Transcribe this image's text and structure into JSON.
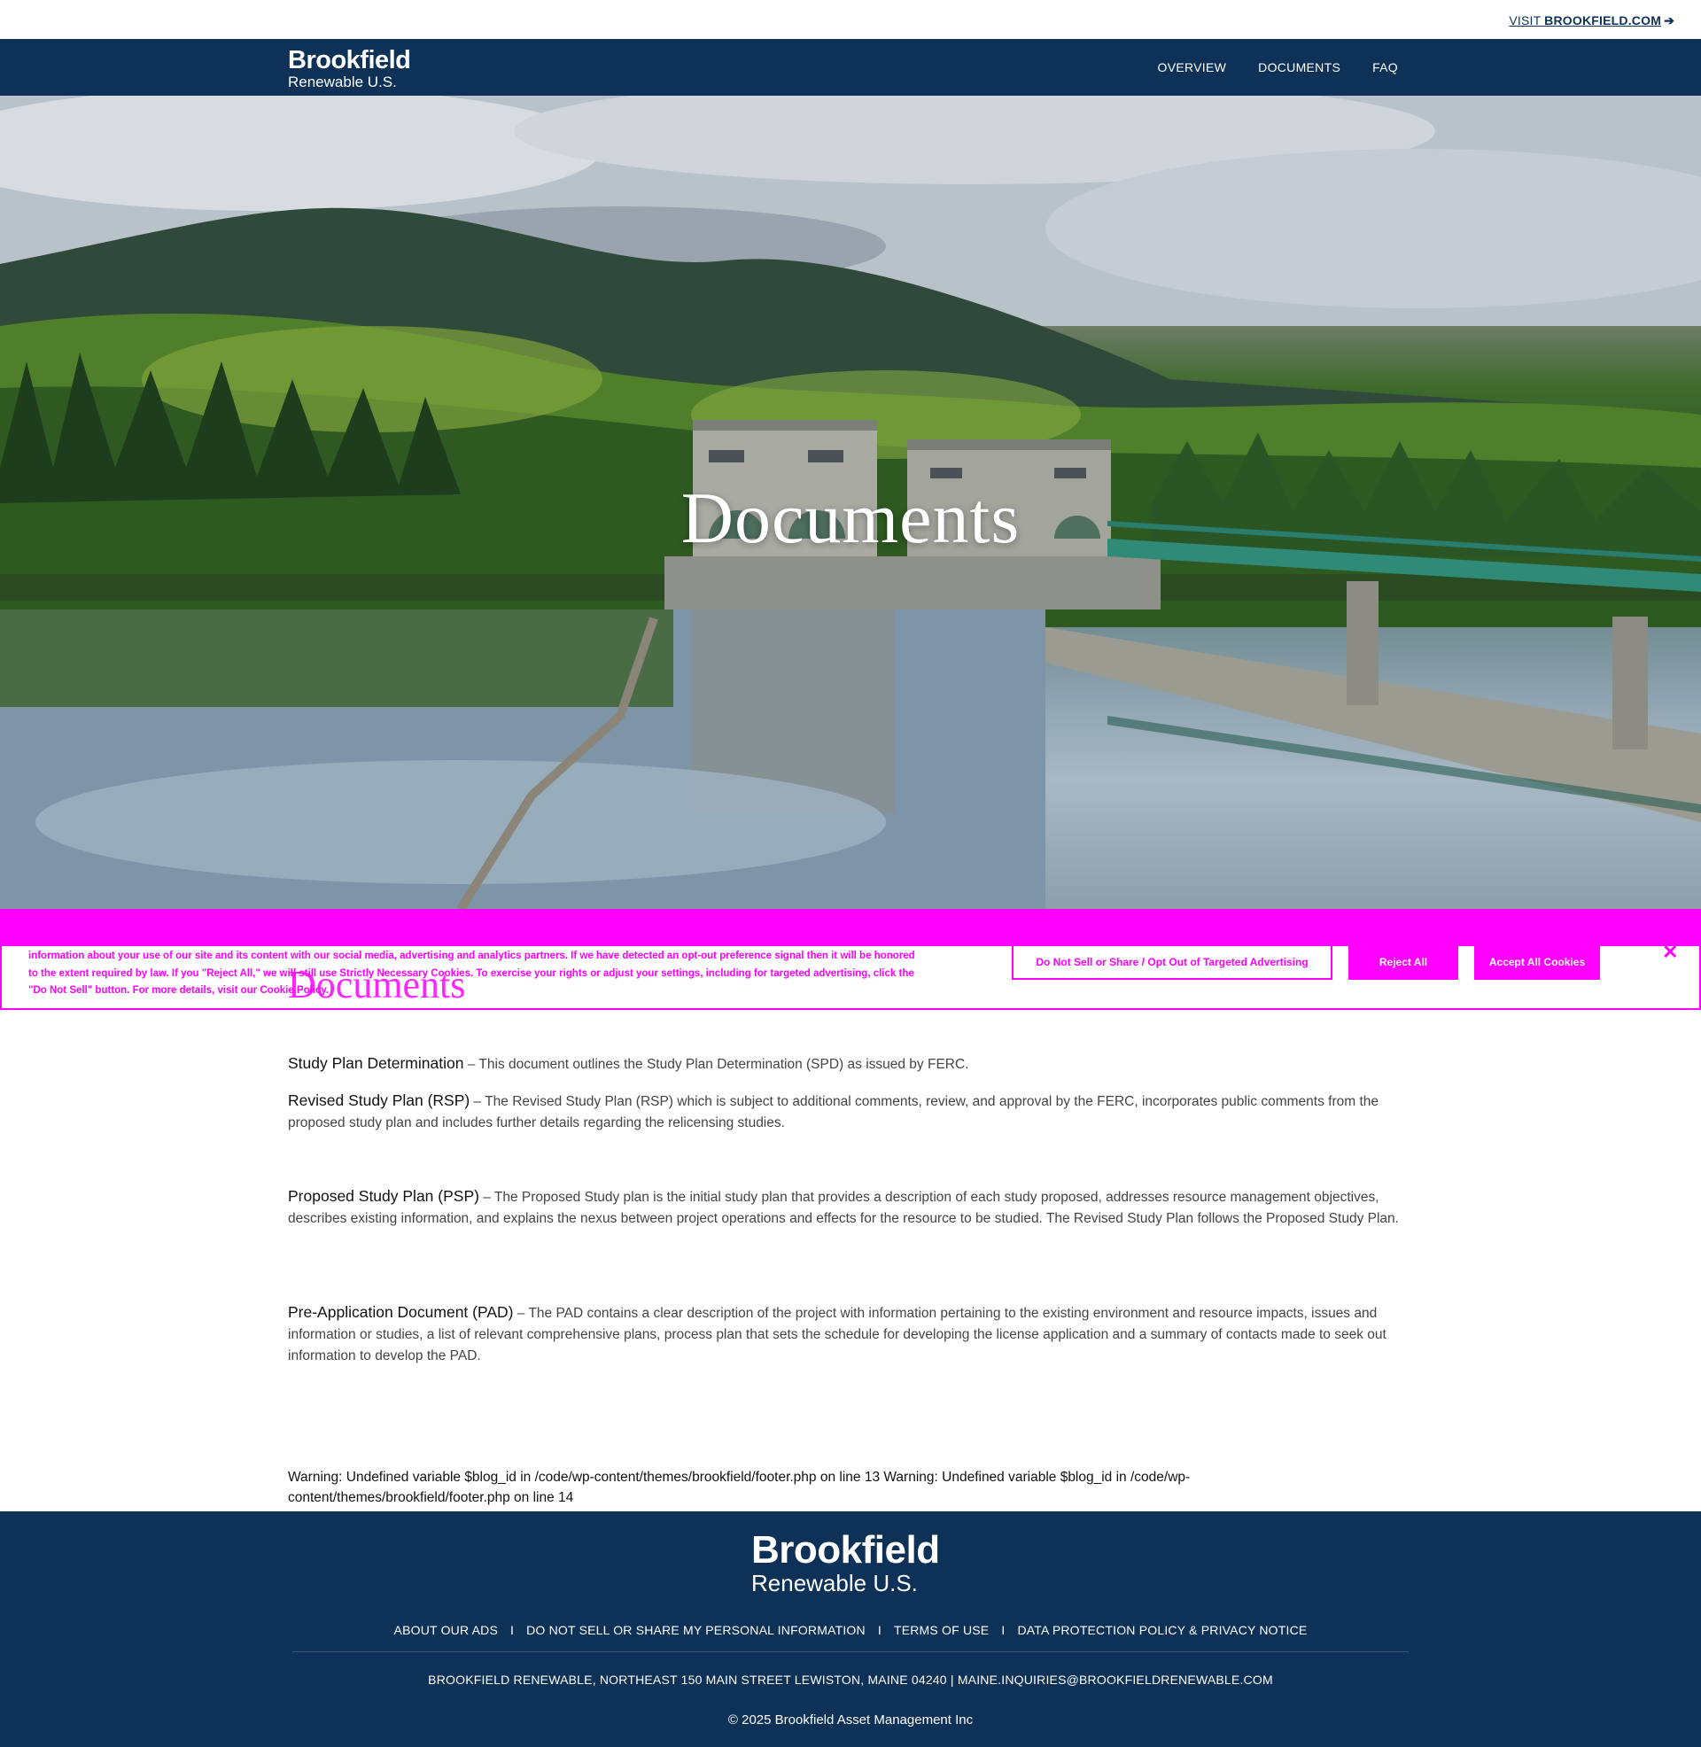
{
  "utility_bar": {
    "visit_prefix": "VISIT ",
    "visit_domain": "BROOKFIELD.COM",
    "visit_arrow": "➔"
  },
  "header": {
    "logo_line1": "Brookfield",
    "logo_line2": "Renewable U.S.",
    "nav": [
      "OVERVIEW",
      "DOCUMENTS",
      "FAQ"
    ]
  },
  "hero": {
    "title": "Documents"
  },
  "cookie_banner": {
    "text": "information about your use of our site and its content with our social media, advertising and analytics partners. If we have detected an opt-out preference signal then it will be honored to the extent required by law. If you \"Reject All,\" we will still use Strictly Necessary Cookies. To exercise your rights or adjust your settings, including for targeted advertising, click the \"Do Not Sell\" button. For more details, visit our Cookie Policy.",
    "do_not_sell_label": "Do Not Sell or Share / Opt Out of Targeted Advertising",
    "reject_label": "Reject All",
    "accept_label": "Accept All Cookies",
    "close_icon": "close-icon",
    "accent_color": "#ff00ff"
  },
  "main": {
    "section_title": "Documents",
    "documents": [
      {
        "title": "Study Plan Determination",
        "description": " – This document outlines the Study Plan Determination (SPD) as issued by FERC."
      },
      {
        "title": "Revised Study Plan (RSP)",
        "description": " – The Revised Study Plan (RSP) which is subject to additional comments, review, and approval by the FERC, incorporates public comments from the proposed study plan and includes further details regarding the relicensing studies."
      },
      {
        "title": "Proposed Study Plan (PSP)",
        "description": " –  The Proposed Study plan is the initial study plan that provides a description of each study proposed, addresses resource management objectives, describes existing information, and explains the nexus between project operations and effects for the resource to be studied.  The Revised Study Plan follows the Proposed Study Plan."
      },
      {
        "title": "Pre-Application Document (PAD)",
        "description": " – The PAD contains a clear description of the project with information pertaining to the existing environment and resource impacts, issues and information or studies, a list of relevant comprehensive plans, process plan that sets the schedule for developing the license application and a summary of contacts made to seek out information to develop the PAD."
      }
    ],
    "warning": "Warning: Undefined variable $blog_id in /code/wp-content/themes/brookfield/footer.php on line 13 Warning: Undefined variable $blog_id in /code/wp-content/themes/brookfield/footer.php on line 14"
  },
  "footer": {
    "logo_line1": "Brookfield",
    "logo_line2": "Renewable U.S.",
    "links": [
      "ABOUT OUR ADS",
      "DO NOT SELL OR SHARE MY PERSONAL INFORMATION",
      "TERMS OF USE",
      "DATA PROTECTION POLICY & PRIVACY NOTICE"
    ],
    "separator": "I",
    "address": "BROOKFIELD RENEWABLE, NORTHEAST 150 MAIN STREET LEWISTON, MAINE 04240 | MAINE.INQUIRIES@BROOKFIELDRENEWABLE.COM",
    "copyright": "© 2025 Brookfield Asset Management Inc"
  },
  "colors": {
    "brand_navy": "#0e3257",
    "cookie_magenta": "#ff00ff"
  }
}
